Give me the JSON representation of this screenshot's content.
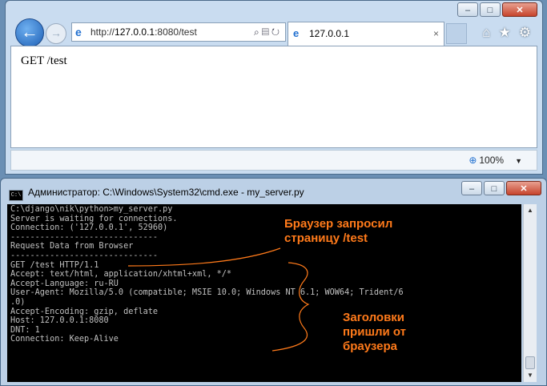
{
  "browser": {
    "back_icon": "back-arrow-icon",
    "forward_icon": "forward-arrow-icon",
    "address": {
      "protocol": "http://",
      "host": "127.0.0.1",
      "path": ":8080/test",
      "tools_icons": [
        "search-icon",
        "compat-view-icon",
        "refresh-icon"
      ]
    },
    "tab": {
      "title": "127.0.0.1",
      "close": "×"
    },
    "toolbar_icons": [
      "home-icon",
      "favorites-star-icon",
      "gear-icon"
    ],
    "page_text": "GET /test",
    "zoom": "100%"
  },
  "cmd": {
    "title": "Администратор: C:\\Windows\\System32\\cmd.exe - my_server.py",
    "lines": [
      "C:\\django\\nik\\python>my_server.py",
      "Server is waiting for connections.",
      "Connection: ('127.0.0.1', 52960)",
      "------------------------------",
      "Request Data from Browser",
      "------------------------------",
      "GET /test HTTP/1.1",
      "Accept: text/html, application/xhtml+xml, */*",
      "Accept-Language: ru-RU",
      "User-Agent: Mozilla/5.0 (compatible; MSIE 10.0; Windows NT 6.1; WOW64; Trident/6",
      ".0)",
      "Accept-Encoding: gzip, deflate",
      "Host: 127.0.0.1:8080",
      "DNT: 1",
      "Connection: Keep-Alive"
    ]
  },
  "annotations": {
    "request": "Браузер запросил страницу /test",
    "headers": "Заголовки пришли от браузера",
    "color": "#ff7a1a"
  },
  "window_buttons": {
    "minimize": "–",
    "maximize": "□",
    "close": "✕"
  }
}
